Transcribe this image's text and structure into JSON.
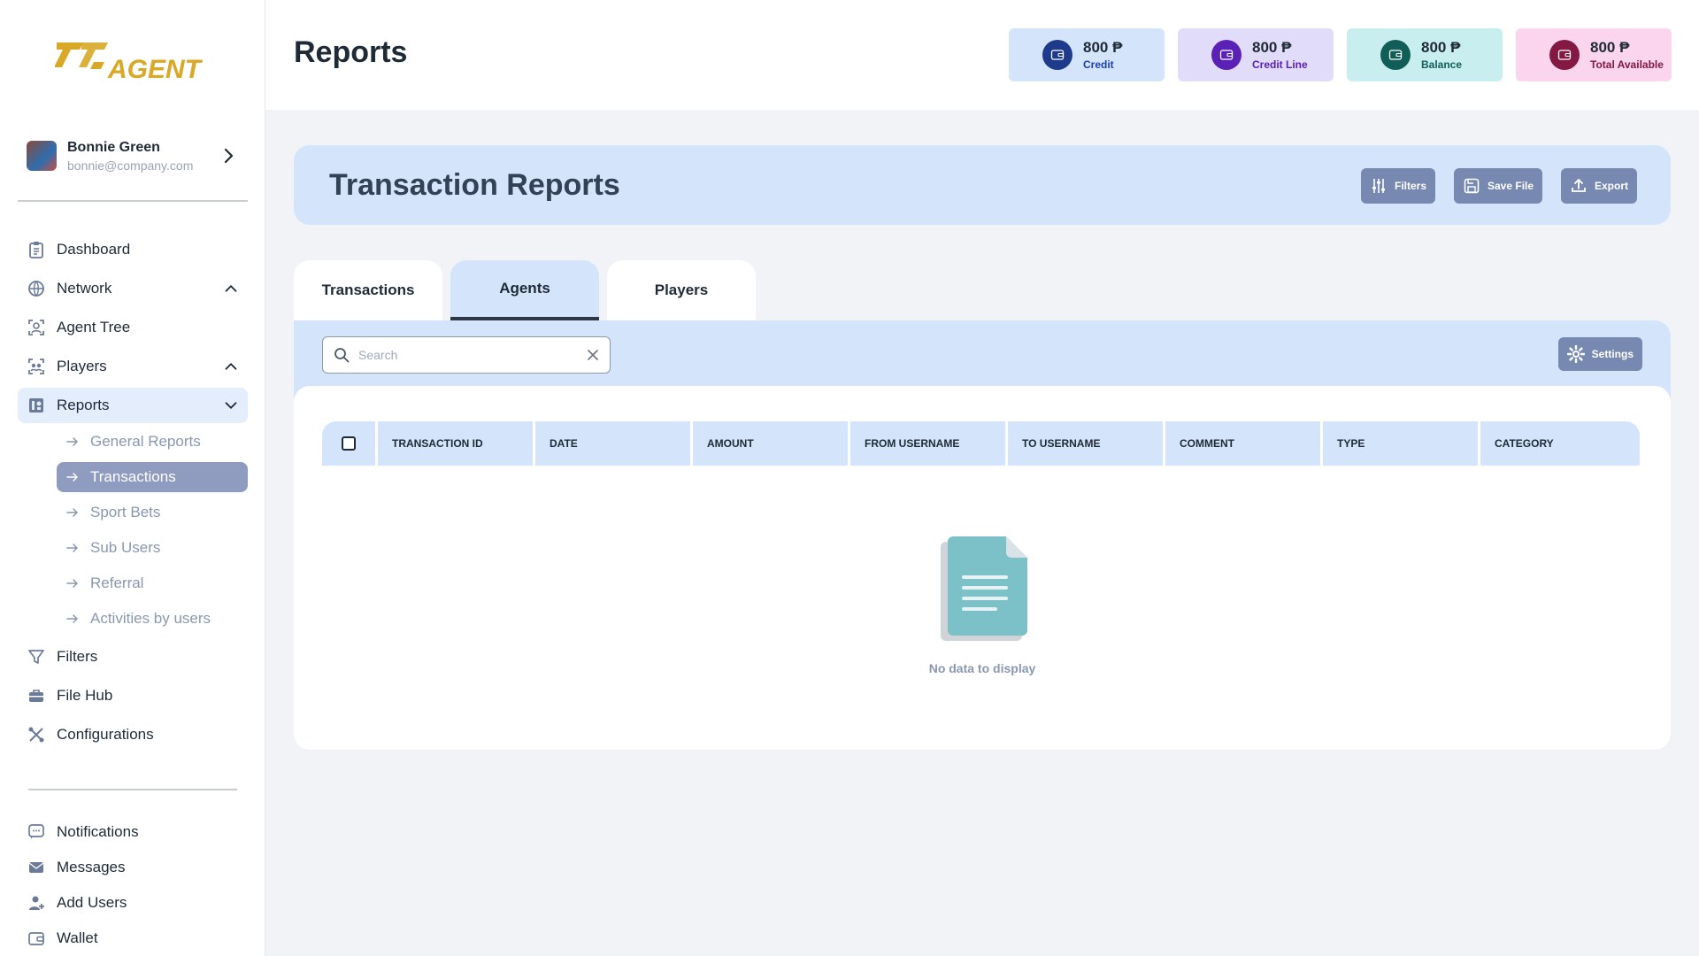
{
  "brand": {
    "logo_text": "777AGENT",
    "logo_color": "#d8a826"
  },
  "user": {
    "name": "Bonnie Green",
    "email": "bonnie@company.com"
  },
  "sidebar": {
    "items": [
      {
        "label": "Dashboard",
        "icon": "clipboard-icon"
      },
      {
        "label": "Network",
        "icon": "globe-icon",
        "chevron": "up"
      },
      {
        "label": "Agent Tree",
        "icon": "agent-scan-icon"
      },
      {
        "label": "Players",
        "icon": "players-scan-icon",
        "chevron": "up"
      },
      {
        "label": "Reports",
        "icon": "reports-icon",
        "chevron": "down",
        "active": true
      }
    ],
    "report_subitems": [
      {
        "label": "General Reports"
      },
      {
        "label": "Transactions",
        "active": true
      },
      {
        "label": "Sport Bets"
      },
      {
        "label": "Sub Users"
      },
      {
        "label": "Referral"
      },
      {
        "label": "Activities by users"
      }
    ],
    "items_after": [
      {
        "label": "Filters",
        "icon": "filter-icon"
      },
      {
        "label": "File Hub",
        "icon": "briefcase-icon"
      },
      {
        "label": "Configurations",
        "icon": "tools-icon"
      }
    ],
    "bottom_items": [
      {
        "label": "Notifications",
        "icon": "chat-icon"
      },
      {
        "label": "Messages",
        "icon": "mail-icon"
      },
      {
        "label": "Add Users",
        "icon": "user-plus-icon"
      },
      {
        "label": "Wallet",
        "icon": "wallet-icon"
      }
    ]
  },
  "header": {
    "title": "Reports",
    "stats": [
      {
        "value": "800 ₱",
        "caption": "Credit",
        "bg": "#d3e4fb",
        "circle": "#1e3a8a",
        "caption_color": "#1e40af"
      },
      {
        "value": "800 ₱",
        "caption": "Credit Line",
        "bg": "#e2dcfb",
        "circle": "#5b21b6",
        "caption_color": "#5b21b6"
      },
      {
        "value": "800 ₱",
        "caption": "Balance",
        "bg": "#c8eef0",
        "circle": "#115e59",
        "caption_color": "#115e59"
      },
      {
        "value": "800 ₱",
        "caption": "Total Available",
        "bg": "#fbd5ee",
        "circle": "#831843",
        "caption_color": "#831843"
      }
    ]
  },
  "banner": {
    "title": "Transaction Reports",
    "buttons": {
      "filters": "Filters",
      "save": "Save File",
      "export": "Export"
    }
  },
  "tabs": [
    {
      "label": "Transactions"
    },
    {
      "label": "Agents",
      "active": true
    },
    {
      "label": "Players"
    }
  ],
  "toolbar": {
    "search_placeholder": "Search",
    "search_value": "",
    "settings_label": "Settings"
  },
  "table": {
    "columns": [
      "TRANSACTION ID",
      "DATE",
      "AMOUNT",
      "FROM USERNAME",
      "TO USERNAME",
      "COMMENT",
      "TYPE",
      "CATEGORY"
    ],
    "rows": [],
    "empty_text": "No data to display"
  },
  "colors": {
    "accent_button": "#7889b1",
    "light_blue": "#d3e4fb",
    "muted_text": "#8a97b0"
  }
}
